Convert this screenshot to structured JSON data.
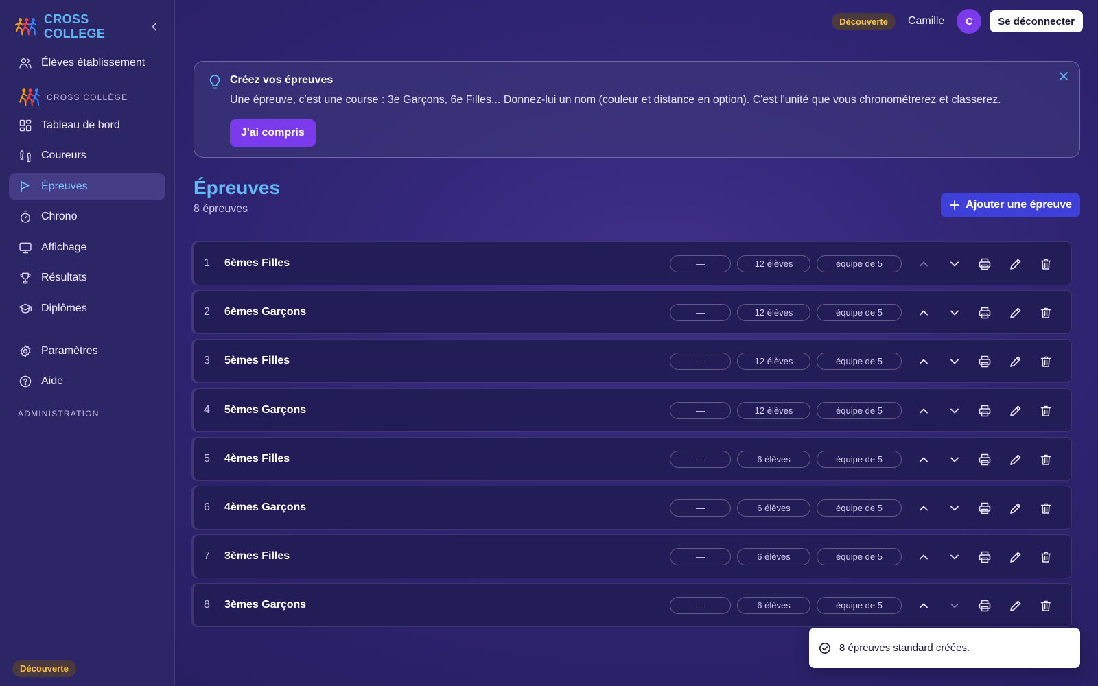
{
  "brand": {
    "name": "CROSS COLLEGE"
  },
  "nav": {
    "top_item": {
      "label": "Élèves établissement",
      "icon": "users-icon"
    },
    "section_title": "CROSS COLLÈGE",
    "items": [
      {
        "label": "Tableau de bord",
        "icon": "dashboard-icon",
        "active": false
      },
      {
        "label": "Coureurs",
        "icon": "footprints-icon",
        "active": false
      },
      {
        "label": "Épreuves",
        "icon": "flag-icon",
        "active": true
      },
      {
        "label": "Chrono",
        "icon": "timer-icon",
        "active": false
      },
      {
        "label": "Affichage",
        "icon": "monitor-icon",
        "active": false
      },
      {
        "label": "Résultats",
        "icon": "trophy-icon",
        "active": false
      },
      {
        "label": "Diplômes",
        "icon": "graduation-cap-icon",
        "active": false
      }
    ],
    "settings": {
      "label": "Paramètres",
      "icon": "gear-icon"
    },
    "help": {
      "label": "Aide",
      "icon": "help-circle-icon"
    },
    "admin_title": "ADMINISTRATION",
    "plan_badge": "Découverte"
  },
  "topbar": {
    "plan_badge": "Découverte",
    "user_name": "Camille",
    "avatar_initial": "C",
    "logout_label": "Se déconnecter"
  },
  "tip": {
    "title": "Créez vos épreuves",
    "text": "Une épreuve, c'est une course : 3e Garçons, 6e Filles... Donnez-lui un nom (couleur et distance en option). C'est l'unité que vous chronométrerez et classerez.",
    "button_label": "J'ai compris"
  },
  "page": {
    "title": "Épreuves",
    "count_label": "8 épreuves",
    "add_label": "Ajouter une épreuve"
  },
  "races": [
    {
      "index": "1",
      "name": "6èmes Filles",
      "color": "—",
      "students": "12 élèves",
      "team": "équipe de 5",
      "up_disabled": true,
      "down_disabled": false
    },
    {
      "index": "2",
      "name": "6èmes Garçons",
      "color": "—",
      "students": "12 élèves",
      "team": "équipe de 5",
      "up_disabled": false,
      "down_disabled": false
    },
    {
      "index": "3",
      "name": "5èmes Filles",
      "color": "—",
      "students": "12 élèves",
      "team": "équipe de 5",
      "up_disabled": false,
      "down_disabled": false
    },
    {
      "index": "4",
      "name": "5èmes Garçons",
      "color": "—",
      "students": "12 élèves",
      "team": "équipe de 5",
      "up_disabled": false,
      "down_disabled": false
    },
    {
      "index": "5",
      "name": "4èmes Filles",
      "color": "—",
      "students": "6 élèves",
      "team": "équipe de 5",
      "up_disabled": false,
      "down_disabled": false
    },
    {
      "index": "6",
      "name": "4èmes Garçons",
      "color": "—",
      "students": "6 élèves",
      "team": "équipe de 5",
      "up_disabled": false,
      "down_disabled": false
    },
    {
      "index": "7",
      "name": "3èmes Filles",
      "color": "—",
      "students": "6 élèves",
      "team": "équipe de 5",
      "up_disabled": false,
      "down_disabled": false
    },
    {
      "index": "8",
      "name": "3èmes Garçons",
      "color": "—",
      "students": "6 élèves",
      "team": "équipe de 5",
      "up_disabled": false,
      "down_disabled": true
    }
  ],
  "toast": {
    "message": "8 épreuves standard créées."
  },
  "colors": {
    "accent": "#7c3aed",
    "primary": "#3f3fd9",
    "link": "#63b8f5",
    "badge": "#f6c24b"
  }
}
